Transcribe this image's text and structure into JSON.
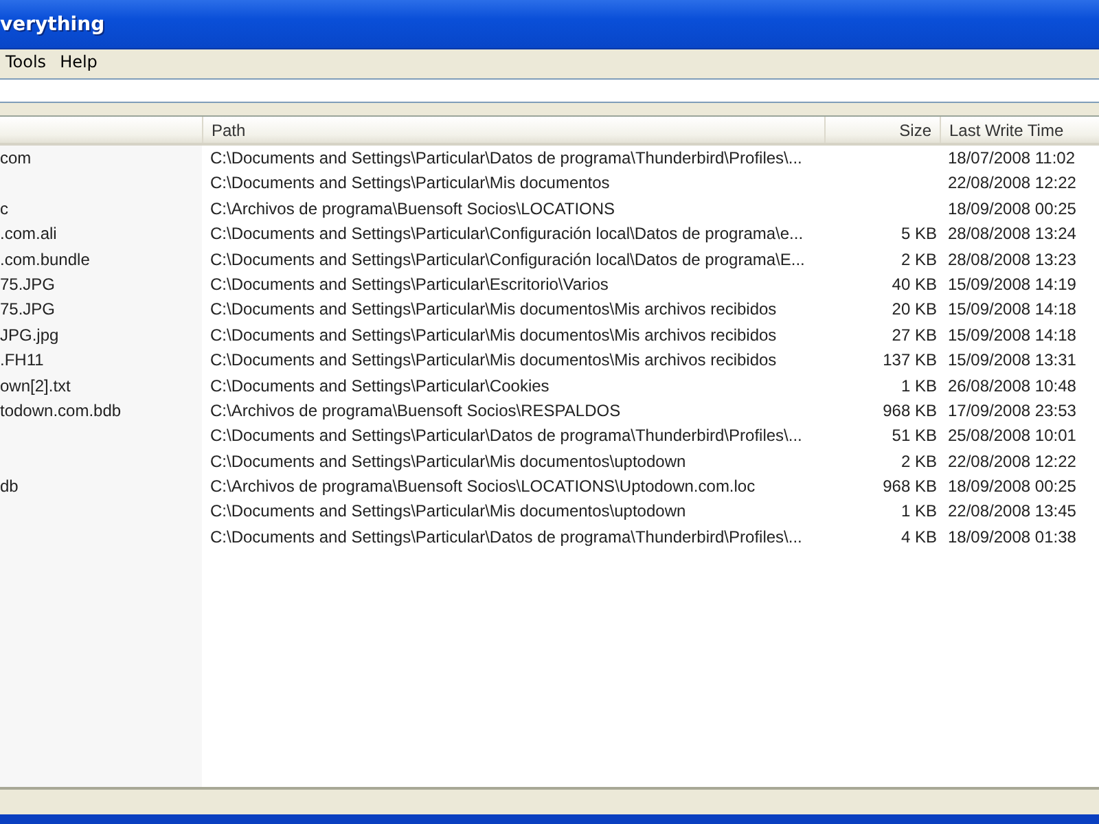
{
  "window": {
    "title": "verything"
  },
  "menu": [
    "Tools",
    "Help"
  ],
  "table": {
    "columns": [
      "Path",
      "Size",
      "Last Write Time"
    ],
    "rows": [
      {
        "column_1": "com",
        "path": "C:\\Documents and Settings\\Particular\\Datos de programa\\Thunderbird\\Profiles\\...",
        "last_write_time": "18/07/2008 11:02"
      },
      {
        "path": "C:\\Documents and Settings\\Particular\\Mis documentos",
        "last_write_time": "22/08/2008 12:22"
      },
      {
        "column_1": "c",
        "path": "C:\\Archivos de programa\\Buensoft Socios\\LOCATIONS",
        "last_write_time": "18/09/2008 00:25"
      },
      {
        "column_1": ".com.ali",
        "path": "C:\\Documents and Settings\\Particular\\Configuración local\\Datos de programa\\e...",
        "size": "5 KB",
        "last_write_time": "28/08/2008 13:24"
      },
      {
        "column_1": ".com.bundle",
        "path": "C:\\Documents and Settings\\Particular\\Configuración local\\Datos de programa\\E...",
        "size": "2 KB",
        "last_write_time": "28/08/2008 13:23"
      },
      {
        "column_1": "75.JPG",
        "path": "C:\\Documents and Settings\\Particular\\Escritorio\\Varios",
        "size": "40 KB",
        "last_write_time": "15/09/2008 14:19"
      },
      {
        "column_1": "75.JPG",
        "path": "C:\\Documents and Settings\\Particular\\Mis documentos\\Mis archivos recibidos",
        "size": "20 KB",
        "last_write_time": "15/09/2008 14:18"
      },
      {
        "column_1": "JPG.jpg",
        "path": "C:\\Documents and Settings\\Particular\\Mis documentos\\Mis archivos recibidos",
        "size": "27 KB",
        "last_write_time": "15/09/2008 14:18"
      },
      {
        "column_1": ".FH11",
        "path": "C:\\Documents and Settings\\Particular\\Mis documentos\\Mis archivos recibidos",
        "size": "137 KB",
        "last_write_time": "15/09/2008 13:31"
      },
      {
        "column_1": "own[2].txt",
        "path": "C:\\Documents and Settings\\Particular\\Cookies",
        "size": "1 KB",
        "last_write_time": "26/08/2008 10:48"
      },
      {
        "column_1": "todown.com.bdb",
        "path": "C:\\Archivos de programa\\Buensoft Socios\\RESPALDOS",
        "size": "968 KB",
        "last_write_time": "17/09/2008 23:53"
      },
      {
        "path": "C:\\Documents and Settings\\Particular\\Datos de programa\\Thunderbird\\Profiles\\...",
        "size": "51 KB",
        "last_write_time": "25/08/2008 10:01"
      },
      {
        "path": "C:\\Documents and Settings\\Particular\\Mis documentos\\uptodown",
        "size": "2 KB",
        "last_write_time": "22/08/2008 12:22"
      },
      {
        "column_1": "db",
        "path": "C:\\Archivos de programa\\Buensoft Socios\\LOCATIONS\\Uptodown.com.loc",
        "size": "968 KB",
        "last_write_time": "18/09/2008 00:25"
      },
      {
        "path": "C:\\Documents and Settings\\Particular\\Mis documentos\\uptodown",
        "size": "1 KB",
        "last_write_time": "22/08/2008 13:45"
      },
      {
        "path": "C:\\Documents and Settings\\Particular\\Datos de programa\\Thunderbird\\Profiles\\...",
        "size": "4 KB",
        "last_write_time": "18/09/2008 01:38"
      }
    ]
  }
}
